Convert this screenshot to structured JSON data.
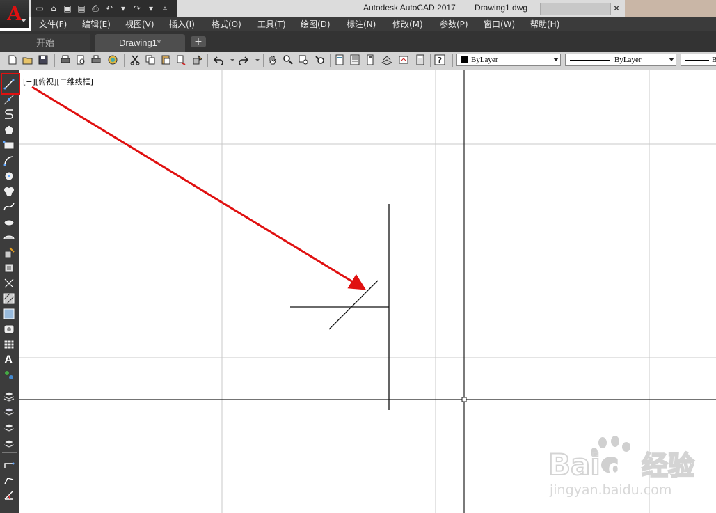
{
  "title_bar": {
    "app_name": "Autodesk AutoCAD 2017",
    "document": "Drawing1.dwg"
  },
  "menu": [
    "文件(F)",
    "编辑(E)",
    "视图(V)",
    "插入(I)",
    "格式(O)",
    "工具(T)",
    "绘图(D)",
    "标注(N)",
    "修改(M)",
    "参数(P)",
    "窗口(W)",
    "帮助(H)"
  ],
  "tabs": {
    "start": "开始",
    "document": "Drawing1*"
  },
  "properties": {
    "color": "ByLayer",
    "linetype": "ByLayer",
    "lineweight_partial": "B"
  },
  "left_toolbar": {
    "text_tool_glyph": "A"
  },
  "viewport": {
    "label": "[−][俯视][二维线框]"
  },
  "watermark": {
    "brand": "Bai",
    "brand_suffix": "du",
    "chinese": "经验",
    "url": "jingyan.baidu.com"
  },
  "colors": {
    "accent_red": "#e01010",
    "menubar": "#3b3b3b",
    "toolbar": "#d4d4d4",
    "grid": "#c8c8c8"
  }
}
